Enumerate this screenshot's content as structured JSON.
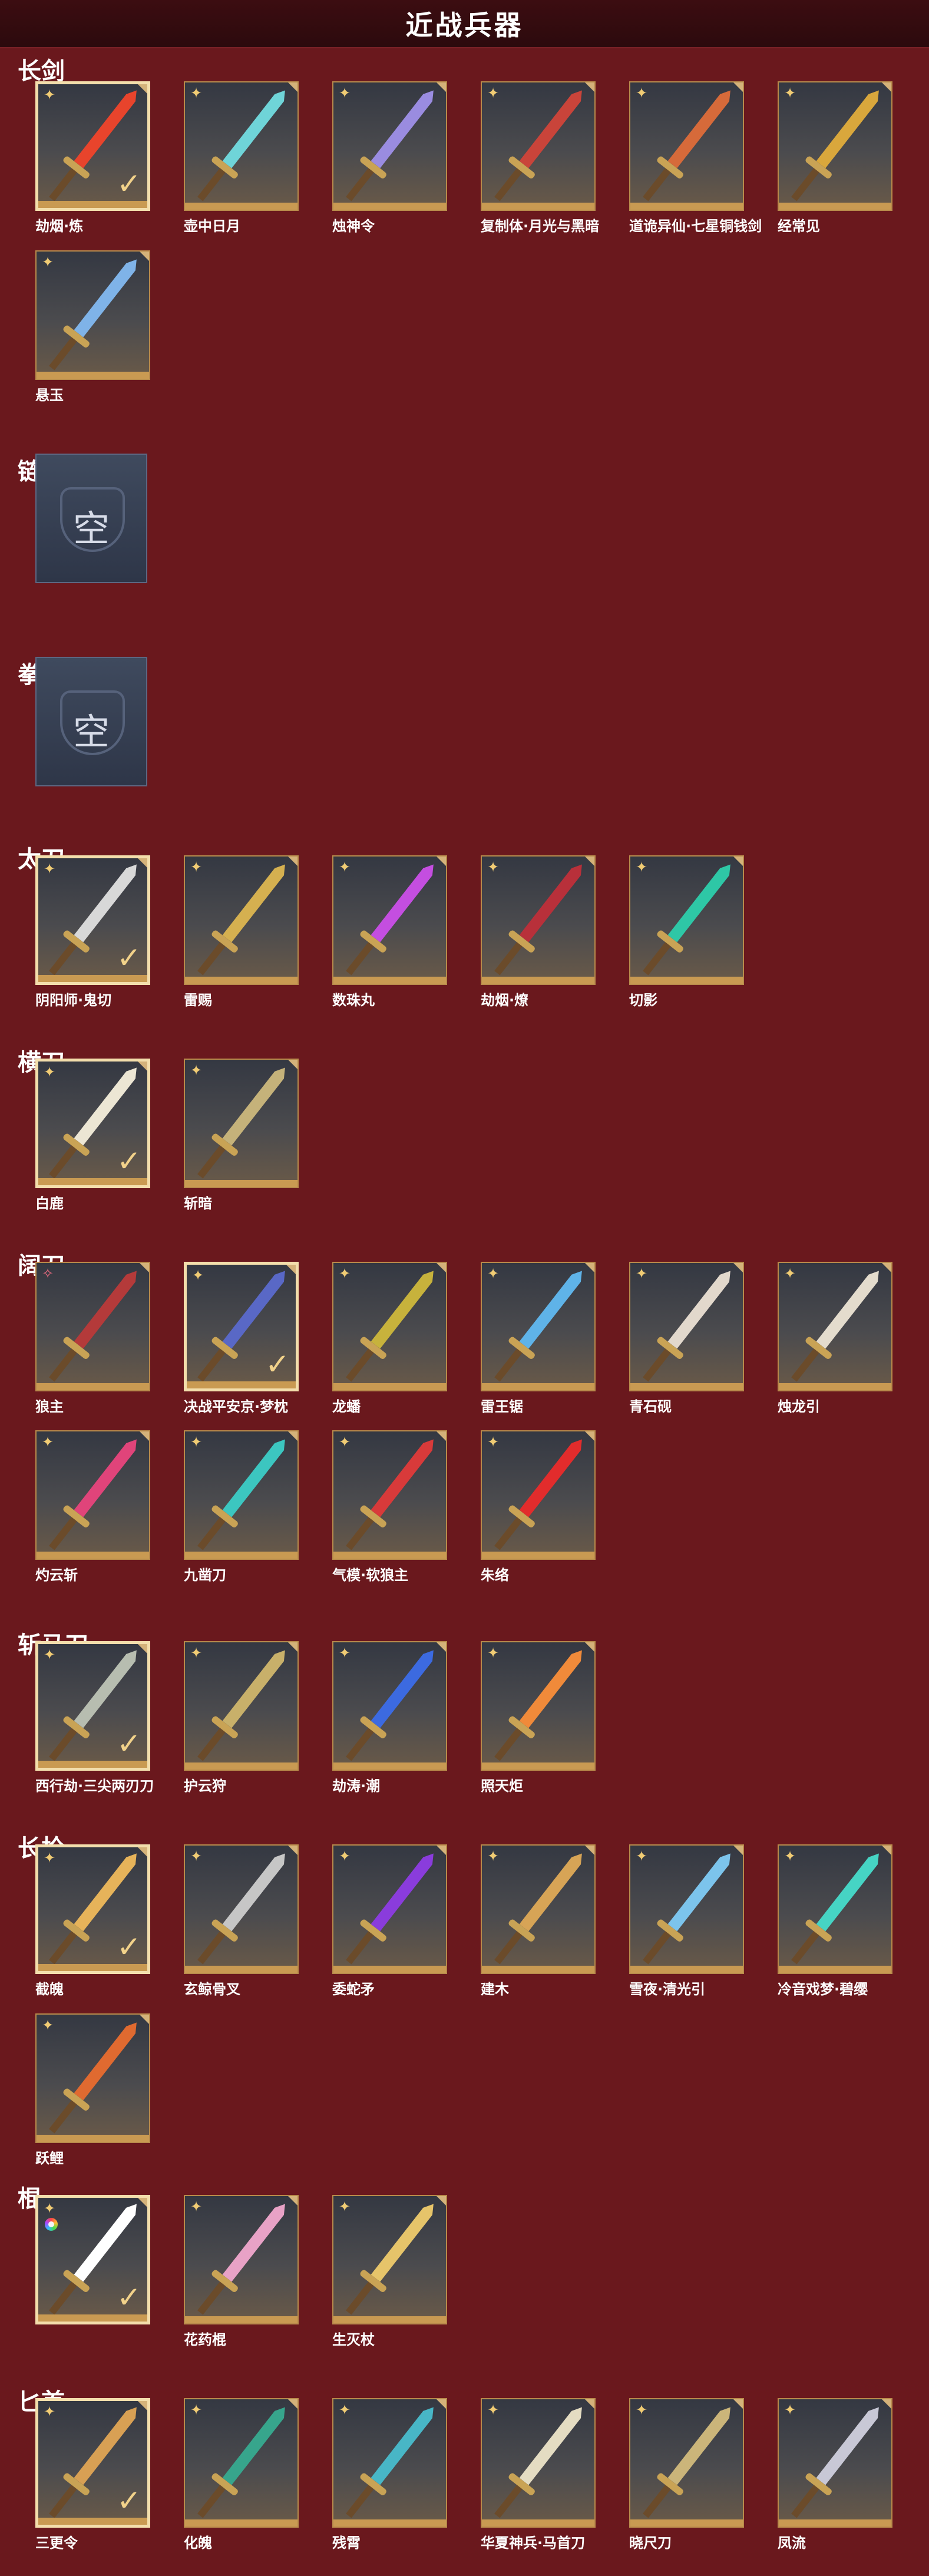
{
  "page": {
    "title": "近战兵器"
  },
  "sections": [
    {
      "label": "长剑",
      "items": [
        {
          "name": "劫烟·炼",
          "selected": true,
          "rarity": "gold",
          "color": "#e8442c"
        },
        {
          "name": "壶中日月",
          "selected": false,
          "rarity": "gold",
          "color": "#6fd4d8"
        },
        {
          "name": "烛神令",
          "selected": false,
          "rarity": "gold",
          "color": "#9a8ce0"
        },
        {
          "name": "复制体·月光与黑暗",
          "selected": false,
          "rarity": "gold",
          "color": "#c9443a"
        },
        {
          "name": "道诡异仙·七星铜钱剑",
          "selected": false,
          "rarity": "gold",
          "color": "#d66a3a"
        },
        {
          "name": "经常见",
          "selected": false,
          "rarity": "gold",
          "color": "#d9a73c"
        },
        {
          "name": "悬玉",
          "selected": false,
          "rarity": "gold",
          "color": "#7fb3e8"
        }
      ]
    },
    {
      "label": "链剑",
      "empty_text": "空",
      "items": []
    },
    {
      "label": "拳刃",
      "empty_text": "空",
      "items": []
    },
    {
      "label": "太刀",
      "items": [
        {
          "name": "阴阳师·鬼切",
          "selected": true,
          "rarity": "gold",
          "color": "#d8d8d8"
        },
        {
          "name": "雷赐",
          "selected": false,
          "rarity": "gold",
          "color": "#d5b050"
        },
        {
          "name": "数珠丸",
          "selected": false,
          "rarity": "gold",
          "color": "#c44ee0"
        },
        {
          "name": "劫烟·燎",
          "selected": false,
          "rarity": "gold",
          "color": "#b8303a"
        },
        {
          "name": "切影",
          "selected": false,
          "rarity": "gold",
          "color": "#2ec7a6"
        }
      ]
    },
    {
      "label": "横刀",
      "items": [
        {
          "name": "白鹿",
          "selected": true,
          "rarity": "gold",
          "color": "#ece6d4"
        },
        {
          "name": "斩暗",
          "selected": false,
          "rarity": "gold",
          "color": "#c5b27a"
        }
      ]
    },
    {
      "label": "阔刀",
      "items": [
        {
          "name": "狼主",
          "selected": false,
          "rarity": "red",
          "color": "#b43a3a"
        },
        {
          "name": "决战平安京·梦枕",
          "selected": true,
          "rarity": "gold",
          "color": "#5968c6"
        },
        {
          "name": "龙蟠",
          "selected": false,
          "rarity": "gold",
          "color": "#c7b23c"
        },
        {
          "name": "雷王锯",
          "selected": false,
          "rarity": "gold",
          "color": "#5fb3e8"
        },
        {
          "name": "青石砚",
          "selected": false,
          "rarity": "gold",
          "color": "#e2d8cc"
        },
        {
          "name": "烛龙引",
          "selected": false,
          "rarity": "gold",
          "color": "#e4dccd"
        },
        {
          "name": "灼云斩",
          "selected": false,
          "rarity": "gold",
          "color": "#e0447a"
        },
        {
          "name": "九凿刀",
          "selected": false,
          "rarity": "gold",
          "color": "#3cc6c0"
        },
        {
          "name": "气模·软狼主",
          "selected": false,
          "rarity": "gold",
          "color": "#d83a3a"
        },
        {
          "name": "朱络",
          "selected": false,
          "rarity": "gold",
          "color": "#e22c2c"
        }
      ]
    },
    {
      "label": "斩马刀",
      "items": [
        {
          "name": "西行劫·三尖两刃刀",
          "selected": true,
          "rarity": "gold",
          "color": "#b7bdb0"
        },
        {
          "name": "护云狩",
          "selected": false,
          "rarity": "gold",
          "color": "#c8b06a"
        },
        {
          "name": "劫涛·潮",
          "selected": false,
          "rarity": "gold",
          "color": "#3c6ae0"
        },
        {
          "name": "照天炬",
          "selected": false,
          "rarity": "gold",
          "color": "#f08a3a"
        }
      ]
    },
    {
      "label": "长枪",
      "items": [
        {
          "name": "截魄",
          "selected": true,
          "rarity": "gold",
          "color": "#e6b35a"
        },
        {
          "name": "玄鲸骨叉",
          "selected": false,
          "rarity": "gold",
          "color": "#c6c6c6"
        },
        {
          "name": "委蛇矛",
          "selected": false,
          "rarity": "gold",
          "color": "#8a3cdc"
        },
        {
          "name": "建木",
          "selected": false,
          "rarity": "gold",
          "color": "#d7a456"
        },
        {
          "name": "雪夜·清光引",
          "selected": false,
          "rarity": "gold",
          "color": "#7cc4ec"
        },
        {
          "name": "冷音戏梦·碧缨",
          "selected": false,
          "rarity": "gold",
          "color": "#46d4c4"
        },
        {
          "name": "跃鲤",
          "selected": false,
          "rarity": "gold",
          "color": "#e06a30"
        }
      ]
    },
    {
      "label": "棍",
      "items": [
        {
          "name": "",
          "selected": true,
          "rarity": "rainbow",
          "color": "#ffffff"
        },
        {
          "name": "花药棍",
          "selected": false,
          "rarity": "gold",
          "color": "#e8a2c6"
        },
        {
          "name": "生灭杖",
          "selected": false,
          "rarity": "gold",
          "color": "#e6c46a"
        }
      ]
    },
    {
      "label": "匕首",
      "items": [
        {
          "name": "三更令",
          "selected": true,
          "rarity": "gold",
          "color": "#d8a054"
        },
        {
          "name": "化魄",
          "selected": false,
          "rarity": "gold",
          "color": "#37a58c"
        },
        {
          "name": "残霄",
          "selected": false,
          "rarity": "gold",
          "color": "#48b6c6"
        },
        {
          "name": "华夏神兵·马首刀",
          "selected": false,
          "rarity": "gold",
          "color": "#e4dcc2"
        },
        {
          "name": "晓尺刀",
          "selected": false,
          "rarity": "gold",
          "color": "#cbb57a"
        },
        {
          "name": "凤流",
          "selected": false,
          "rarity": "gold",
          "color": "#c8c8d6"
        }
      ]
    }
  ]
}
